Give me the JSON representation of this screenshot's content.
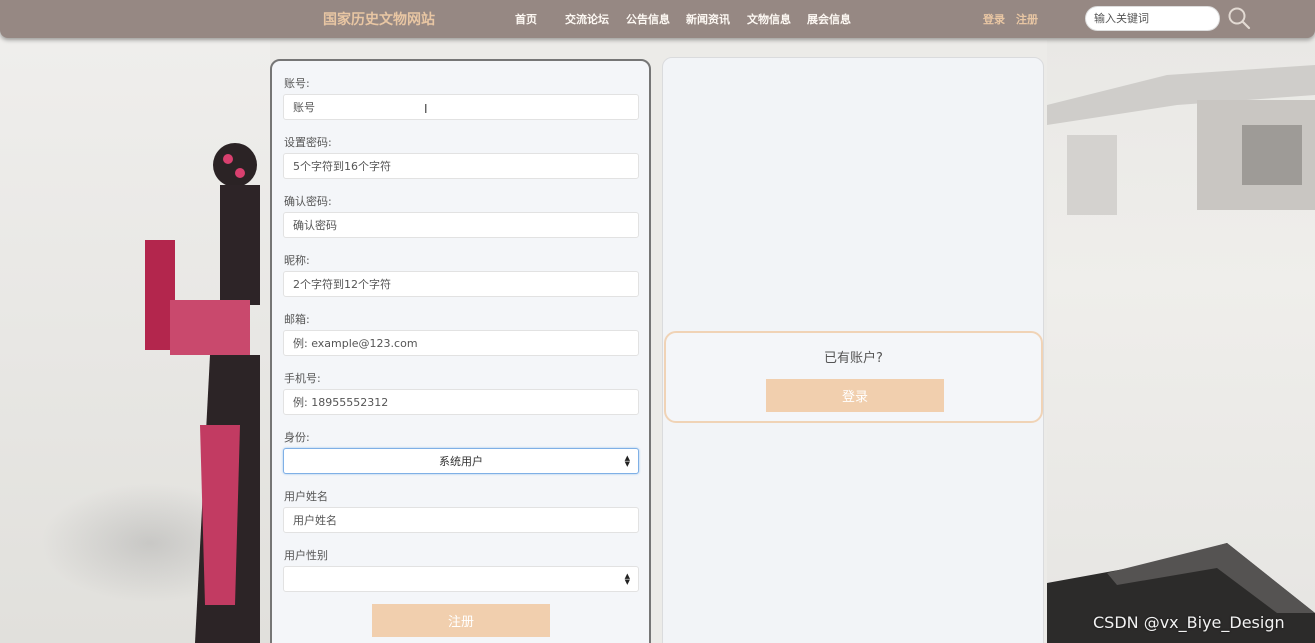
{
  "header": {
    "site_title": "国家历史文物网站",
    "nav": [
      "首页",
      "交流论坛",
      "公告信息",
      "新闻资讯",
      "文物信息",
      "展会信息"
    ],
    "login": "登录",
    "register": "注册",
    "search_placeholder": "输入关键词",
    "search_icon": "search-icon"
  },
  "form": {
    "fields": [
      {
        "label": "账号:",
        "placeholder": "账号"
      },
      {
        "label": "设置密码:",
        "placeholder": "5个字符到16个字符"
      },
      {
        "label": "确认密码:",
        "placeholder": "确认密码"
      },
      {
        "label": "昵称:",
        "placeholder": "2个字符到12个字符"
      },
      {
        "label": "邮箱:",
        "placeholder": "例: example@123.com"
      },
      {
        "label": "手机号:",
        "placeholder": "例: 18955552312"
      }
    ],
    "identity_label": "身份:",
    "identity_value": "系统用户",
    "name_label": "用户姓名",
    "name_placeholder": "用户姓名",
    "gender_label": "用户性别",
    "gender_value": "",
    "submit": "注册"
  },
  "side": {
    "have_account": "已有账户?",
    "login_button": "登录"
  },
  "watermark": "CSDN @vx_Biye_Design",
  "colors": {
    "nav_bg": "#968883",
    "accent": "#f1cfae",
    "title_color": "#e8c6a3"
  }
}
